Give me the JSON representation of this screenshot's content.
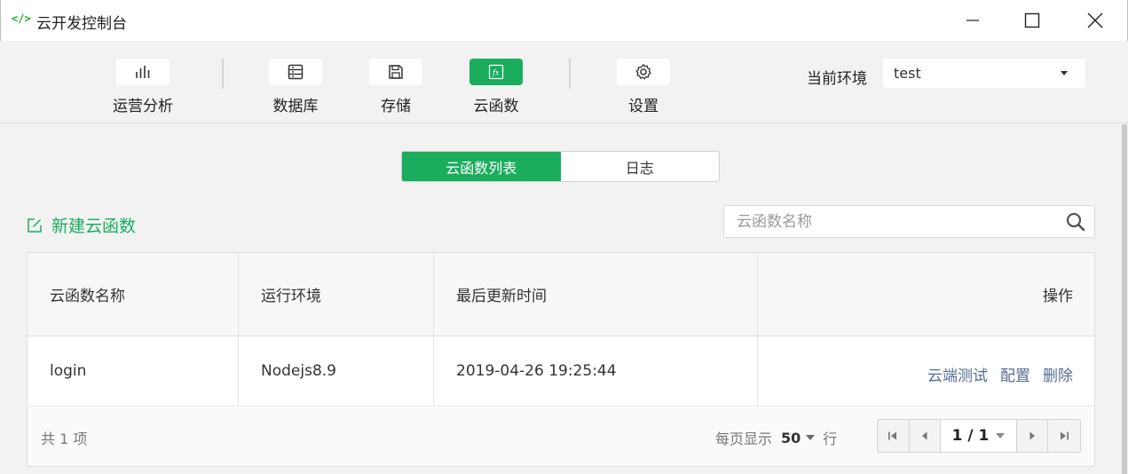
{
  "window": {
    "app_icon": "</>",
    "title": "云开发控制台"
  },
  "toolbar": {
    "items": [
      {
        "label": "运营分析",
        "icon": "bar-chart-icon"
      },
      {
        "label": "数据库",
        "icon": "database-icon"
      },
      {
        "label": "存储",
        "icon": "save-icon"
      },
      {
        "label": "云函数",
        "icon": "function-icon",
        "active": true
      },
      {
        "label": "设置",
        "icon": "gear-icon"
      }
    ],
    "env_label": "当前环境",
    "env_value": "test"
  },
  "tabs": [
    {
      "label": "云函数列表",
      "active": true
    },
    {
      "label": "日志",
      "active": false
    }
  ],
  "actions": {
    "new_function": "新建云函数",
    "search_placeholder": "云函数名称"
  },
  "table": {
    "columns": [
      "云函数名称",
      "运行环境",
      "最后更新时间",
      "操作"
    ],
    "rows": [
      {
        "name": "login",
        "runtime": "Nodejs8.9",
        "updated": "2019-04-26 19:25:44",
        "ops": [
          "云端测试",
          "配置",
          "删除"
        ]
      }
    ]
  },
  "footer": {
    "total": "共 1 项",
    "per_page_label": "每页显示",
    "per_page_value": "50",
    "per_page_unit": "行",
    "page": "1 / 1"
  },
  "colors": {
    "accent": "#1aad5e",
    "link": "#576b95"
  }
}
